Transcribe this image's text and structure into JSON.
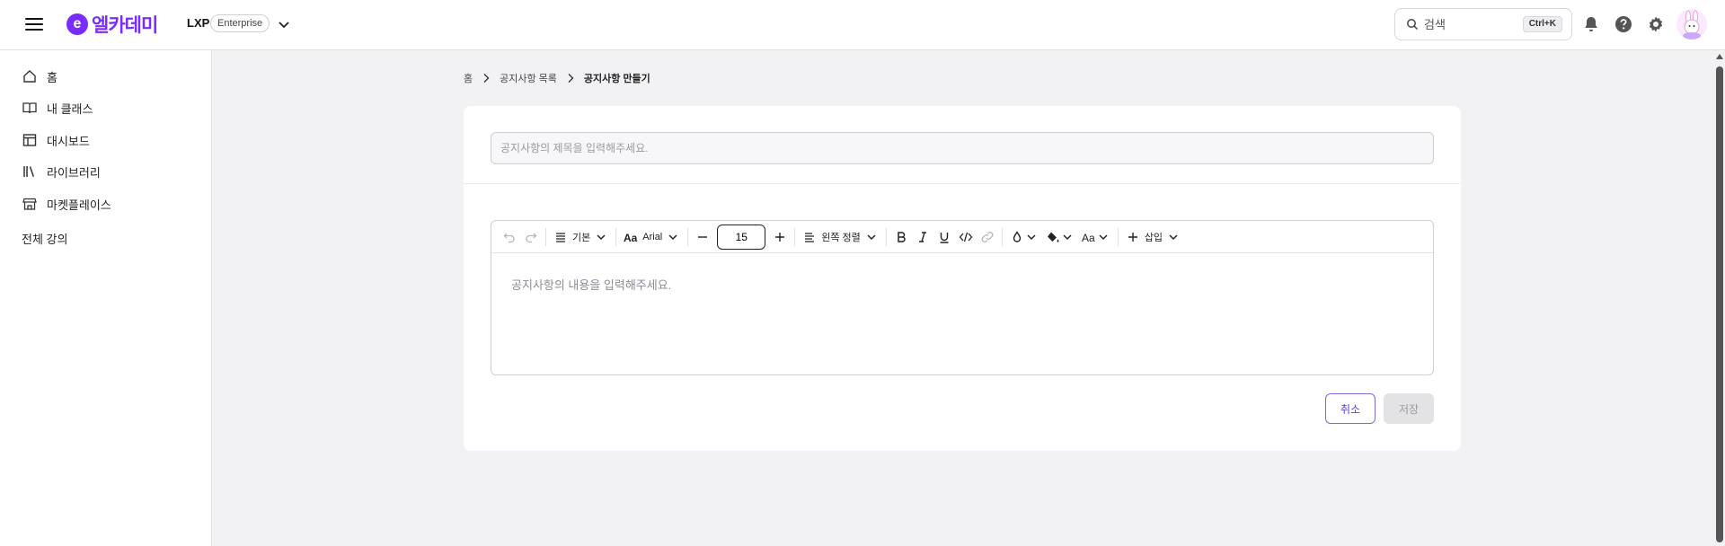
{
  "header": {
    "logo_mark": "e",
    "logo_text": "엘카데미",
    "product": "LXP",
    "edition_badge": "Enterprise",
    "search": {
      "placeholder": "검색",
      "shortcut": "Ctrl+K"
    },
    "icons": [
      "menu-icon",
      "chevron-down-icon",
      "search-icon",
      "bell-icon",
      "help-icon",
      "gear-icon",
      "avatar"
    ]
  },
  "sidebar": {
    "items": [
      {
        "label": "홈",
        "icon": "home-icon"
      },
      {
        "label": "내 클래스",
        "icon": "book-open-icon"
      },
      {
        "label": "대시보드",
        "icon": "layout-icon"
      },
      {
        "label": "라이브러리",
        "icon": "library-icon"
      },
      {
        "label": "마켓플레이스",
        "icon": "store-icon"
      }
    ],
    "all_courses": "전체 강의"
  },
  "breadcrumb": {
    "home": "홈",
    "list": "공지사항 목록",
    "current": "공지사항 만들기"
  },
  "form": {
    "title_placeholder": "공지사항의 제목을 입력해주세요.",
    "content_placeholder": "공지사항의 내용을 입력해주세요.",
    "cancel_label": "취소",
    "save_label": "저장"
  },
  "toolbar": {
    "block_style": "기본",
    "font_family": "Arial",
    "font_size": "15",
    "align": "왼쪽 정렬",
    "insert": "삽입"
  },
  "colors": {
    "brand": "#7a2cff",
    "cancel_border": "#7a6cd6",
    "save_disabled_bg": "#e3e3e6"
  }
}
